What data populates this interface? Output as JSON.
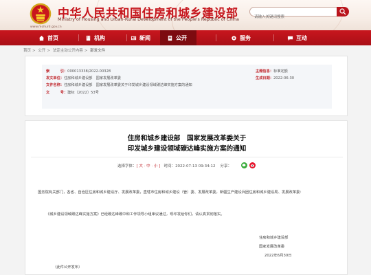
{
  "header": {
    "title": "中华人民共和国住房和城乡建设部",
    "subtitle": "Ministry of Housing and Urban-Rural Development of the People's Republic of China",
    "url": "www.mohurd.gov.cn",
    "search_placeholder": "请输入关键词搜索",
    "accent_color": "#c6161d"
  },
  "nav": {
    "items": [
      {
        "label": "首页",
        "icon": "home-icon"
      },
      {
        "label": "机构",
        "icon": "building-icon"
      },
      {
        "label": "新闻",
        "icon": "news-icon"
      },
      {
        "label": "公开",
        "icon": "public-icon"
      },
      {
        "label": "服务",
        "icon": "service-icon"
      },
      {
        "label": "互动",
        "icon": "interaction-icon"
      }
    ],
    "active_index": 3
  },
  "breadcrumb": [
    "首页",
    "公开",
    "法定主动公开内容",
    "部发文件"
  ],
  "meta": {
    "index_key": "索　　　引：",
    "index_val": "000013338/2022-00328",
    "topic_key": "主题信息：",
    "topic_val": "标准定额",
    "issuer_key": "发文单位：",
    "issuer_val": "住房和城乡建设部　国家发展改革委",
    "date_key": "生成日期：",
    "date_val": "2022-06-30",
    "name_key": "文件名称：",
    "name_val": "住房和城乡建设部　国家发展改革委关于印发城乡建设领域碳达峰实施方案的通知",
    "number_key": "文　　　号：",
    "number_val": "建标〔2022〕53号"
  },
  "article": {
    "title_line1": "住房和城乡建设部　国家发展改革委关于",
    "title_line2": "印发城乡建设领域碳达峰实施方案的通知",
    "font_size_label": "选择字体：",
    "font_sizes": "[ 大 · 中 · 小 ]",
    "date_label": "时间：",
    "date": "2022-07-13 09:34:12",
    "share_label": "分享：",
    "para1": "国务院有关部门，各省、自治区住房和城乡建设厅、发展改革委，直辖市住房和城乡建设（管）委、发展改革委，新疆生产建设兵团住房和城乡建设局、发展改革委：",
    "para2": "《城乡建设领域碳达峰实施方案》已经碳达峰碳中和工作领导小组审议通过，现印发给你们，请认真贯彻落实。",
    "sign1": "住房和城乡建设部",
    "sign2": "国家发展改革委",
    "sign3": "2022年6月30日",
    "note": "（此件公开发布）"
  }
}
